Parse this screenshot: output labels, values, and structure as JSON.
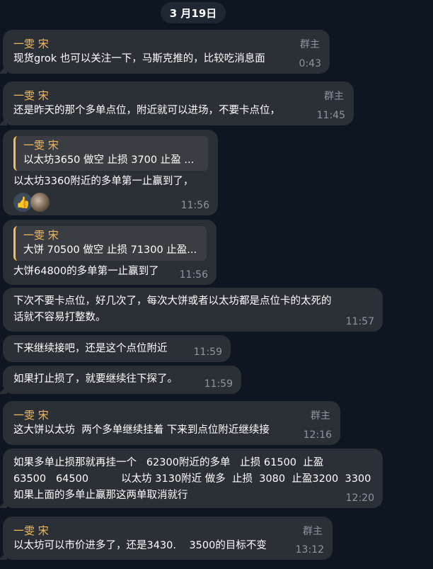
{
  "date_label": "3 月19日",
  "messages": [
    {
      "sender": "一雯 宋",
      "role": "群主",
      "text": "现货grok 也可以关注一下，马斯克推的，比较吃消息面",
      "time": "0:43"
    },
    {
      "sender": "一雯 宋",
      "role": "群主",
      "text": "还是昨天的那个多单点位，附近就可以进场，不要卡点位，",
      "time": "11:45"
    },
    {
      "quote_sender": "一雯 宋",
      "quote_text": "以太坊3650 做空  止损 3700 止盈 ...",
      "text": "以太坊3360附近的多单第一止赢到了，",
      "reactions": [
        "👍",
        "avatar"
      ],
      "time": "11:56"
    },
    {
      "quote_sender": "一雯 宋",
      "quote_text": "大饼 70500 做空 止损 71300 止盈...",
      "text": "大饼64800的多单第一止赢到了",
      "time": "11:56"
    },
    {
      "text": "下次不要卡点位，好几次了，每次大饼或者以太坊都是点位卡的太死的\n话就不容易打整数。",
      "time": "11:57"
    },
    {
      "text": "下来继续接吧，还是这个点位附近",
      "time": "11:59"
    },
    {
      "text": "如果打止损了，就要继续往下探了。",
      "time": "11:59"
    },
    {
      "sender": "一雯 宋",
      "role": "群主",
      "text": "这大饼以太坊  两个多单继续挂着 下来到点位附近继续接",
      "time": "12:16"
    },
    {
      "text": "如果多单止损那就再挂一个   62300附近的多单   止损 61500  止盈\n63500   64500          以太坊 3130附近 做多  止损  3080  止盈3200  3300\n如果上面的多单止赢那这两单取消就行",
      "time": "12:20"
    },
    {
      "sender": "一雯 宋",
      "role": "群主",
      "text": "以太坊可以市价进多了，还是3430.    3500的目标不变",
      "time": "13:12"
    }
  ]
}
